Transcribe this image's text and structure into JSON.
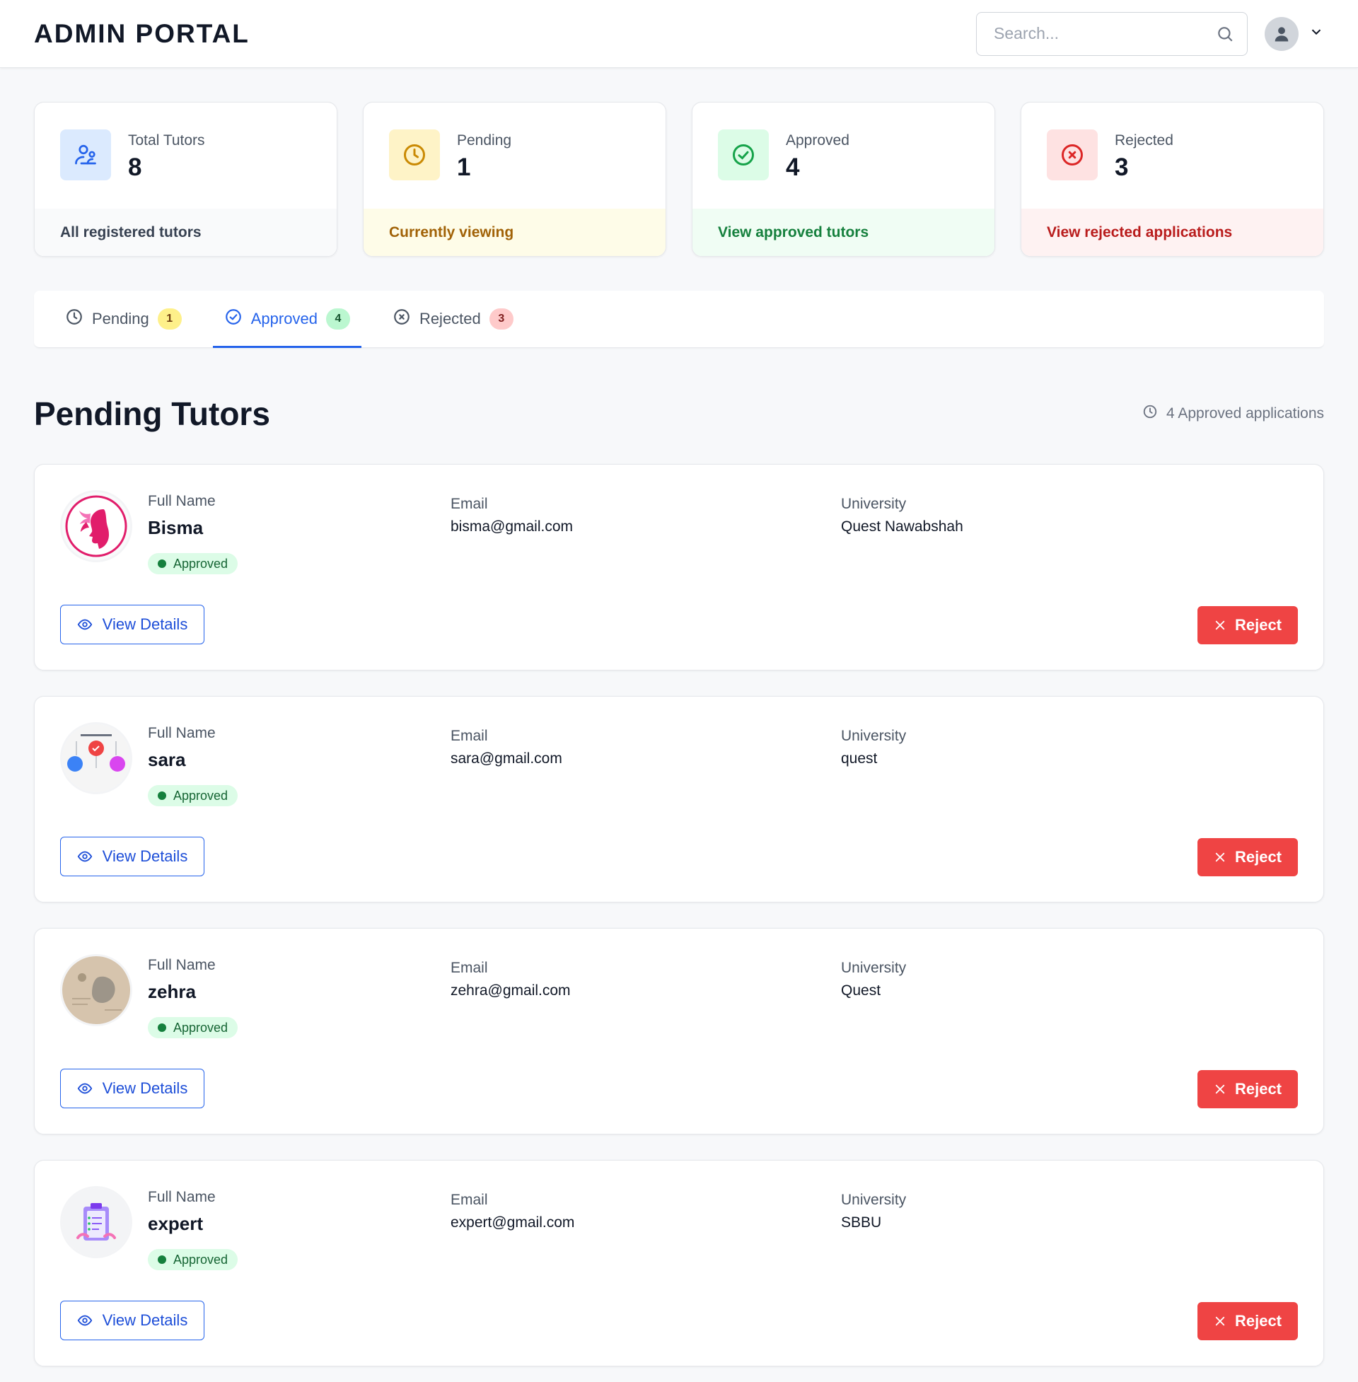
{
  "header": {
    "title": "ADMIN PORTAL",
    "search_placeholder": "Search...",
    "search_icon": "search-icon",
    "user_icon": "user-icon",
    "menu_icon": "chevron-down-icon"
  },
  "stats": [
    {
      "key": "total",
      "label": "Total Tutors",
      "value": "8",
      "footer": "All registered tutors",
      "icon": "users-icon",
      "icon_bg": "#dbeafe",
      "icon_color": "#2563eb",
      "footer_bg": "#f9fafb",
      "footer_color": "#374151"
    },
    {
      "key": "pending",
      "label": "Pending",
      "value": "1",
      "footer": "Currently viewing",
      "icon": "clock-icon",
      "icon_bg": "#fef3c7",
      "icon_color": "#ca8a04",
      "footer_bg": "#fefce8",
      "footer_color": "#a16207"
    },
    {
      "key": "approved",
      "label": "Approved",
      "value": "4",
      "footer": "View approved tutors",
      "icon": "check-circle-icon",
      "icon_bg": "#dcfce7",
      "icon_color": "#16a34a",
      "footer_bg": "#f0fdf4",
      "footer_color": "#15803d"
    },
    {
      "key": "rejected",
      "label": "Rejected",
      "value": "3",
      "footer": "View rejected applications",
      "icon": "x-circle-icon",
      "icon_bg": "#fee2e2",
      "icon_color": "#dc2626",
      "footer_bg": "#fef2f2",
      "footer_color": "#b91c1c"
    }
  ],
  "tabs": [
    {
      "label": "Pending",
      "count": "1",
      "icon": "clock-icon",
      "badge_bg": "#fef08a",
      "badge_color": "#713f12",
      "active": false
    },
    {
      "label": "Approved",
      "count": "4",
      "icon": "check-circle-icon",
      "badge_bg": "#bbf7d0",
      "badge_color": "#14532d",
      "active": true
    },
    {
      "label": "Rejected",
      "count": "3",
      "icon": "x-circle-icon",
      "badge_bg": "#fecaca",
      "badge_color": "#7f1d1d",
      "active": false
    }
  ],
  "section": {
    "title": "Pending Tutors",
    "note": "4 Approved applications",
    "note_icon": "clock-icon"
  },
  "labels": {
    "full_name": "Full Name",
    "email": "Email",
    "university": "University",
    "view_details": "View Details",
    "reject": "Reject"
  },
  "tutors": [
    {
      "name": "Bisma",
      "email": "bisma@gmail.com",
      "university": "Quest Nawabshah",
      "status": "Approved",
      "photo": "woman-silhouette-logo"
    },
    {
      "name": "sara",
      "email": "sara@gmail.com",
      "university": "quest",
      "status": "Approved",
      "photo": "infographic-image"
    },
    {
      "name": "zehra",
      "email": "zehra@gmail.com",
      "university": "Quest",
      "status": "Approved",
      "photo": "vintage-map-image"
    },
    {
      "name": "expert",
      "email": "expert@gmail.com",
      "university": "SBBU",
      "status": "Approved",
      "photo": "clipboard-illustration"
    }
  ],
  "colors": {
    "accent": "#2563eb",
    "danger": "#ef4444",
    "success_bg": "#dcfce7",
    "success_text": "#166534"
  }
}
